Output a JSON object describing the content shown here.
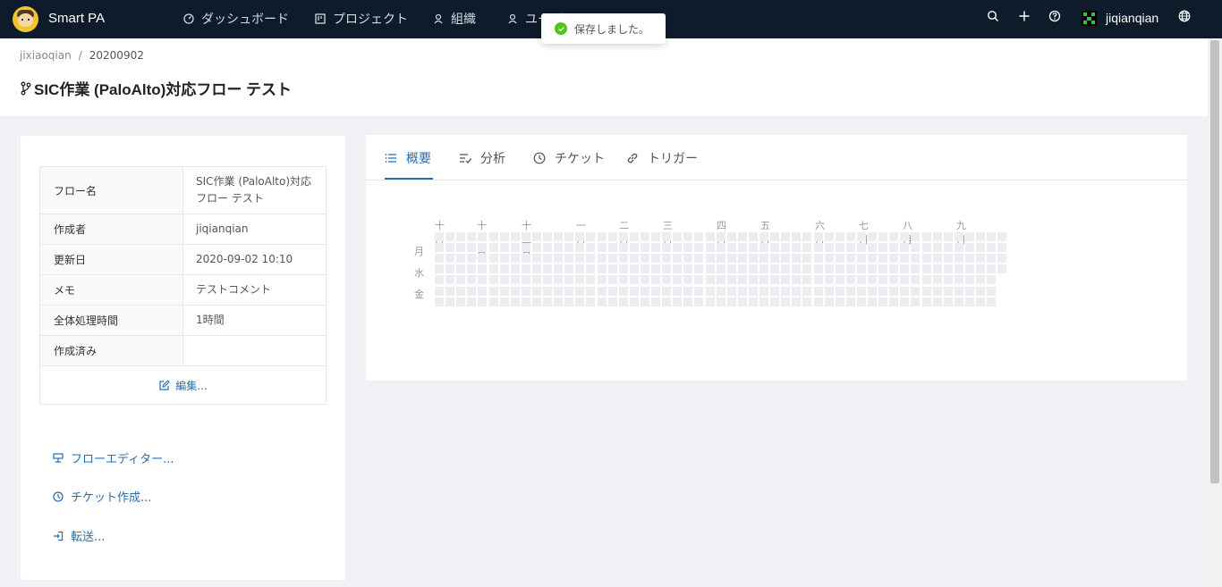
{
  "app": {
    "name": "Smart PA"
  },
  "nav": {
    "items": [
      {
        "label": "ダッシュボード",
        "icon": "dashboard-icon"
      },
      {
        "label": "プロジェクト",
        "icon": "project-icon"
      },
      {
        "label": "組織",
        "icon": "organization-icon"
      },
      {
        "label": "ユーザー",
        "icon": "user-icon"
      }
    ],
    "user": "jiqianqian"
  },
  "toast": {
    "message": "保存しました。"
  },
  "breadcrumb": {
    "parent": "jixiaoqian",
    "separator": "/",
    "current": "20200902"
  },
  "page_title": "SIC作業 (PaloAlto)対応フロー テスト",
  "info": [
    {
      "key": "フロー名",
      "value": "SIC作業 (PaloAlto)対応フロー テスト"
    },
    {
      "key": "作成者",
      "value": "jiqianqian"
    },
    {
      "key": "更新日",
      "value": "2020-09-02 10:10"
    },
    {
      "key": "メモ",
      "value": "テストコメント"
    },
    {
      "key": "全体処理時間",
      "value": "1時間"
    },
    {
      "key": "作成済み",
      "value": ""
    }
  ],
  "edit_label": "編集...",
  "actions": [
    {
      "label": "フローエディター...",
      "icon": "flow-editor-icon"
    },
    {
      "label": "チケット作成...",
      "icon": "ticket-create-icon"
    },
    {
      "label": "転送...",
      "icon": "transfer-icon"
    }
  ],
  "tabs": [
    {
      "label": "概要",
      "icon": "list-icon",
      "active": true
    },
    {
      "label": "分析",
      "icon": "checklist-icon",
      "active": false
    },
    {
      "label": "チケット",
      "icon": "ticket-icon",
      "active": false
    },
    {
      "label": "トリガー",
      "icon": "link-icon",
      "active": false
    }
  ],
  "heatmap": {
    "months": [
      "十月",
      "十一月",
      "十二月",
      "一月",
      "二月",
      "三月",
      "四月",
      "五月",
      "六月",
      "七月",
      "八月",
      "九月"
    ],
    "days": [
      "月",
      "水",
      "金"
    ],
    "weeks": 53,
    "empty_color": "#ebedf0"
  },
  "colors": {
    "accent": "#2b6cb0",
    "nav_bg": "#0d1b2a",
    "success": "#52c41a"
  }
}
